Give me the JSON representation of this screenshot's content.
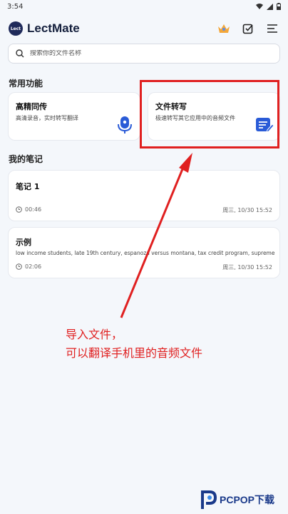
{
  "status": {
    "time": "3:54"
  },
  "header": {
    "logo_text": "Lect",
    "title": "LectMate",
    "icons": [
      "crown-icon",
      "checklist-icon",
      "menu-icon"
    ]
  },
  "search": {
    "placeholder": "搜索你的文件名称"
  },
  "common": {
    "title": "常用功能",
    "cards": [
      {
        "title": "高精同传",
        "subtitle": "高清录音，实时转写翻译",
        "icon": "microphone-icon"
      },
      {
        "title": "文件转写",
        "subtitle": "极速转写其它应用中的音频文件",
        "icon": "file-transcribe-icon"
      }
    ]
  },
  "notes": {
    "title": "我的笔记",
    "items": [
      {
        "title": "笔记 1",
        "preview": "",
        "duration": "00:46",
        "date": "周三, 10/30 15:52"
      },
      {
        "title": "示例",
        "preview": "low income students, late 19th century, espanoza versus montana, tax credit program, supreme cou...",
        "duration": "02:06",
        "date": "周三, 10/30 15:52"
      }
    ]
  },
  "annotation": {
    "text": "导入文件，\n可以翻译手机里的音频文件"
  },
  "colors": {
    "accent": "#2a5bd7",
    "annotation": "#e02020",
    "logo_bg": "#1f2a5a"
  },
  "watermark": {
    "text": "PCPOP下载"
  }
}
